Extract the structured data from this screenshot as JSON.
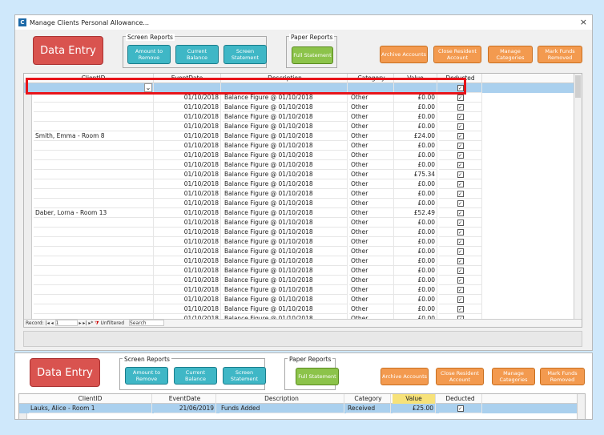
{
  "window": {
    "title": "Manage Clients Personal Allowance...",
    "close_label": "×"
  },
  "top": {
    "data_entry": "Data Entry",
    "screen_reports": {
      "label": "Screen Reports",
      "amount_to_remove": "Amount to Remove",
      "current_balance": "Current Balance",
      "screen_statement": "Screen Statement"
    },
    "paper_reports": {
      "label": "Paper Reports",
      "full_statement": "Full Statement"
    },
    "actions": {
      "archive_accounts": "Archive Accounts",
      "close_resident_account": "Close Resident Account",
      "manage_categories": "Manage Categories",
      "mark_funds_removed": "Mark Funds Removed"
    },
    "grid": {
      "columns": [
        "ClientID",
        "EventDate",
        "Description",
        "Category",
        "Value",
        "Deducted"
      ],
      "rows": [
        {
          "client": "",
          "date": "",
          "desc": "",
          "cat": "",
          "val": "",
          "ded": true
        },
        {
          "client": "",
          "date": "01/10/2018",
          "desc": "Balance Figure @ 01/10/2018",
          "cat": "Other",
          "val": "£0.00",
          "ded": true
        },
        {
          "client": "",
          "date": "01/10/2018",
          "desc": "Balance Figure @ 01/10/2018",
          "cat": "Other",
          "val": "£0.00",
          "ded": true
        },
        {
          "client": "",
          "date": "01/10/2018",
          "desc": "Balance Figure @ 01/10/2018",
          "cat": "Other",
          "val": "£0.00",
          "ded": true
        },
        {
          "client": "",
          "date": "01/10/2018",
          "desc": "Balance Figure @ 01/10/2018",
          "cat": "Other",
          "val": "£0.00",
          "ded": true
        },
        {
          "client": "Smith, Emma - Room 8",
          "date": "01/10/2018",
          "desc": "Balance Figure @ 01/10/2018",
          "cat": "Other",
          "val": "£24.00",
          "ded": true
        },
        {
          "client": "",
          "date": "01/10/2018",
          "desc": "Balance Figure @ 01/10/2018",
          "cat": "Other",
          "val": "£0.00",
          "ded": true
        },
        {
          "client": "",
          "date": "01/10/2018",
          "desc": "Balance Figure @ 01/10/2018",
          "cat": "Other",
          "val": "£0.00",
          "ded": true
        },
        {
          "client": "",
          "date": "01/10/2018",
          "desc": "Balance Figure @ 01/10/2018",
          "cat": "Other",
          "val": "£0.00",
          "ded": true
        },
        {
          "client": "",
          "date": "01/10/2018",
          "desc": "Balance Figure @ 01/10/2018",
          "cat": "Other",
          "val": "£75.34",
          "ded": true
        },
        {
          "client": "",
          "date": "01/10/2018",
          "desc": "Balance Figure @ 01/10/2018",
          "cat": "Other",
          "val": "£0.00",
          "ded": true
        },
        {
          "client": "",
          "date": "01/10/2018",
          "desc": "Balance Figure @ 01/10/2018",
          "cat": "Other",
          "val": "£0.00",
          "ded": true
        },
        {
          "client": "",
          "date": "01/10/2018",
          "desc": "Balance Figure @ 01/10/2018",
          "cat": "Other",
          "val": "£0.00",
          "ded": true
        },
        {
          "client": "Daber, Lorna - Room 13",
          "date": "01/10/2018",
          "desc": "Balance Figure @ 01/10/2018",
          "cat": "Other",
          "val": "£52.49",
          "ded": true
        },
        {
          "client": "",
          "date": "01/10/2018",
          "desc": "Balance Figure @ 01/10/2018",
          "cat": "Other",
          "val": "£0.00",
          "ded": true
        },
        {
          "client": "",
          "date": "01/10/2018",
          "desc": "Balance Figure @ 01/10/2018",
          "cat": "Other",
          "val": "£0.00",
          "ded": true
        },
        {
          "client": "",
          "date": "01/10/2018",
          "desc": "Balance Figure @ 01/10/2018",
          "cat": "Other",
          "val": "£0.00",
          "ded": true
        },
        {
          "client": "",
          "date": "01/10/2018",
          "desc": "Balance Figure @ 01/10/2018",
          "cat": "Other",
          "val": "£0.00",
          "ded": true
        },
        {
          "client": "",
          "date": "01/10/2018",
          "desc": "Balance Figure @ 01/10/2018",
          "cat": "Other",
          "val": "£0.00",
          "ded": true
        },
        {
          "client": "",
          "date": "01/10/2018",
          "desc": "Balance Figure @ 01/10/2018",
          "cat": "Other",
          "val": "£0.00",
          "ded": true
        },
        {
          "client": "",
          "date": "01/10/2018",
          "desc": "Balance Figure @ 01/10/2018",
          "cat": "Other",
          "val": "£0.00",
          "ded": true
        },
        {
          "client": "",
          "date": "01/10/2018",
          "desc": "Balance Figure @ 01/10/2018",
          "cat": "Other",
          "val": "£0.00",
          "ded": true
        },
        {
          "client": "",
          "date": "01/10/2018",
          "desc": "Balance Figure @ 01/10/2018",
          "cat": "Other",
          "val": "£0.00",
          "ded": true
        },
        {
          "client": "",
          "date": "01/10/2018",
          "desc": "Balance Figure @ 01/10/2018",
          "cat": "Other",
          "val": "£0.00",
          "ded": true
        },
        {
          "client": "",
          "date": "01/10/2018",
          "desc": "Balance Figure @ 01/10/2018",
          "cat": "Other",
          "val": "£0.00",
          "ded": true
        }
      ]
    },
    "status": {
      "record_label": "Record:",
      "record_value": "1",
      "filter": "Unfiltered",
      "search": "Search"
    }
  },
  "bottom": {
    "data_entry": "Data Entry",
    "screen_reports": {
      "label": "Screen Reports",
      "amount_to_remove": "Amount to Remove",
      "current_balance": "Current Balance",
      "screen_statement": "Screen Statement"
    },
    "paper_reports": {
      "label": "Paper Reports",
      "full_statement": "Full Statement"
    },
    "actions": {
      "archive_accounts": "Archive Accounts",
      "close_resident_account": "Close Resident Account",
      "manage_categories": "Manage Categories",
      "mark_funds_removed": "Mark Funds Removed"
    },
    "grid": {
      "columns": [
        "ClientID",
        "EventDate",
        "Description",
        "Category",
        "Value",
        "Deducted"
      ],
      "rows": [
        {
          "client": "Lauks, Alice - Room 1",
          "date": "21/06/2019",
          "desc": "Funds Added",
          "cat": "Received",
          "val": "£25.00",
          "ded": true
        }
      ]
    }
  },
  "colors": {
    "highlight": "#e8141a",
    "selected_row": "#aad0ee"
  }
}
